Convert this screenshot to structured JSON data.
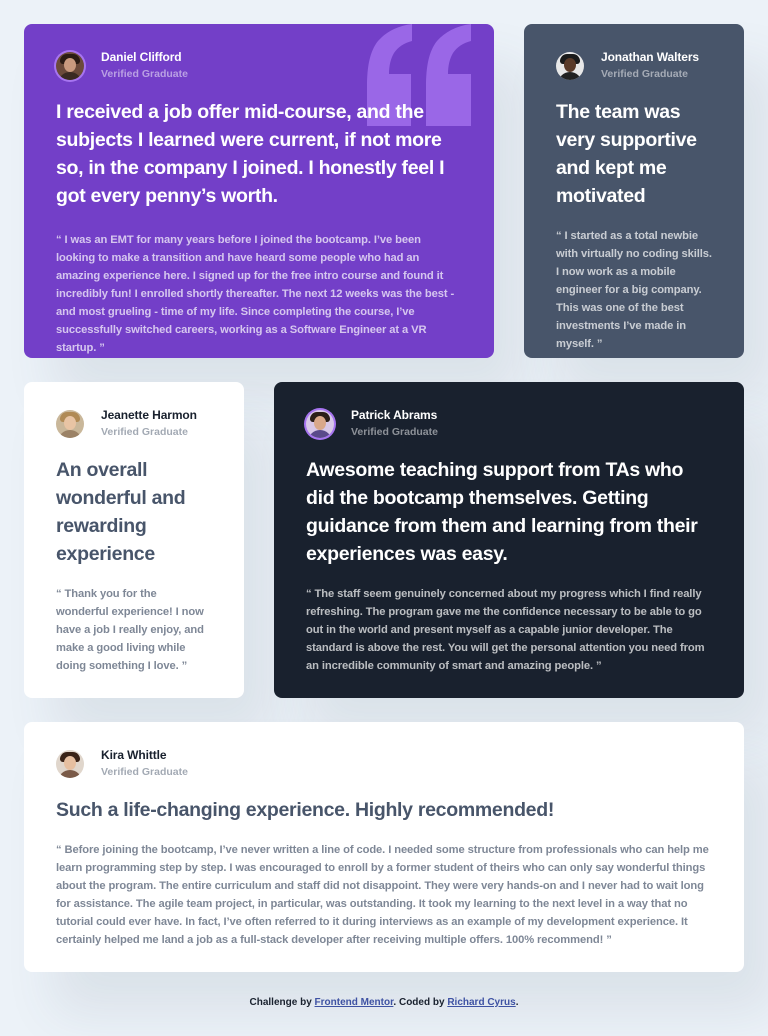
{
  "colors": {
    "page_bg": "#ECF2F8",
    "moderate_violet": "#733FC8",
    "grayish_blue": "#48556A",
    "very_dark_blackish_blue": "#19212E",
    "white": "#FFFFFF",
    "light_violet": "#A775F1",
    "link_blue": "#3E52A3"
  },
  "testimonials": {
    "daniel": {
      "name": "Daniel Clifford",
      "status": "Verified Graduate",
      "headline": "I received a job offer mid-course, and the subjects I learned were current, if not more so, in the company I joined. I honestly feel I got every penny’s worth.",
      "body": "“ I was an EMT for many years before I joined the bootcamp. I’ve been looking to make a transition and have heard some people who had an amazing experience here. I signed up for the free intro course and found it incredibly fun! I enrolled shortly thereafter. The next 12 weeks was the best - and most grueling - time of my life. Since completing the course, I’ve successfully switched careers, working as a Software Engineer at a VR startup. ”",
      "quote_icon": "quotation-mark-icon"
    },
    "jonathan": {
      "name": "Jonathan Walters",
      "status": "Verified Graduate",
      "headline": "The team was very supportive and kept me motivated",
      "body": "“ I started as a total newbie with virtually no coding skills. I now work as a mobile engineer for a big company. This was one of the best investments I’ve made in myself. ”"
    },
    "jeanette": {
      "name": "Jeanette Harmon",
      "status": "Verified Graduate",
      "headline": "An overall wonderful and rewarding experience",
      "body": "“ Thank you for the wonderful experience! I now have a job I really enjoy, and make a good living while doing something I love. ”"
    },
    "patrick": {
      "name": "Patrick Abrams",
      "status": "Verified Graduate",
      "headline": "Awesome teaching support from TAs who did the bootcamp themselves. Getting guidance from them and learning from their experiences was easy.",
      "body": "“ The staff seem genuinely concerned about my progress which I find really refreshing. The program gave me the confidence necessary to be able to go out in the world and present myself as a capable junior developer. The standard is above the rest. You will get the personal attention you need from an incredible community of smart and amazing people. ”"
    },
    "kira": {
      "name": "Kira Whittle",
      "status": "Verified Graduate",
      "headline": "Such a life-changing experience. Highly recommended!",
      "body": "“ Before joining the bootcamp, I’ve never written a line of code. I needed some structure from professionals who can help me learn programming step by step. I was encouraged to enroll by a former student of theirs who can only say wonderful things about the program. The entire curriculum and staff did not disappoint. They were very hands-on and I never had to wait long for assistance. The agile team project, in particular, was outstanding. It took my learning to the next level in a way that no tutorial could ever have. In fact, I’ve often referred to it during interviews as an example of my development experience. It certainly helped me land a job as a full-stack developer after receiving multiple offers. 100% recommend! ”"
    }
  },
  "footer": {
    "prefix": "Challenge by ",
    "link1": "Frontend Mentor",
    "middle": ". Coded by ",
    "link2": "Richard Cyrus",
    "suffix": "."
  }
}
